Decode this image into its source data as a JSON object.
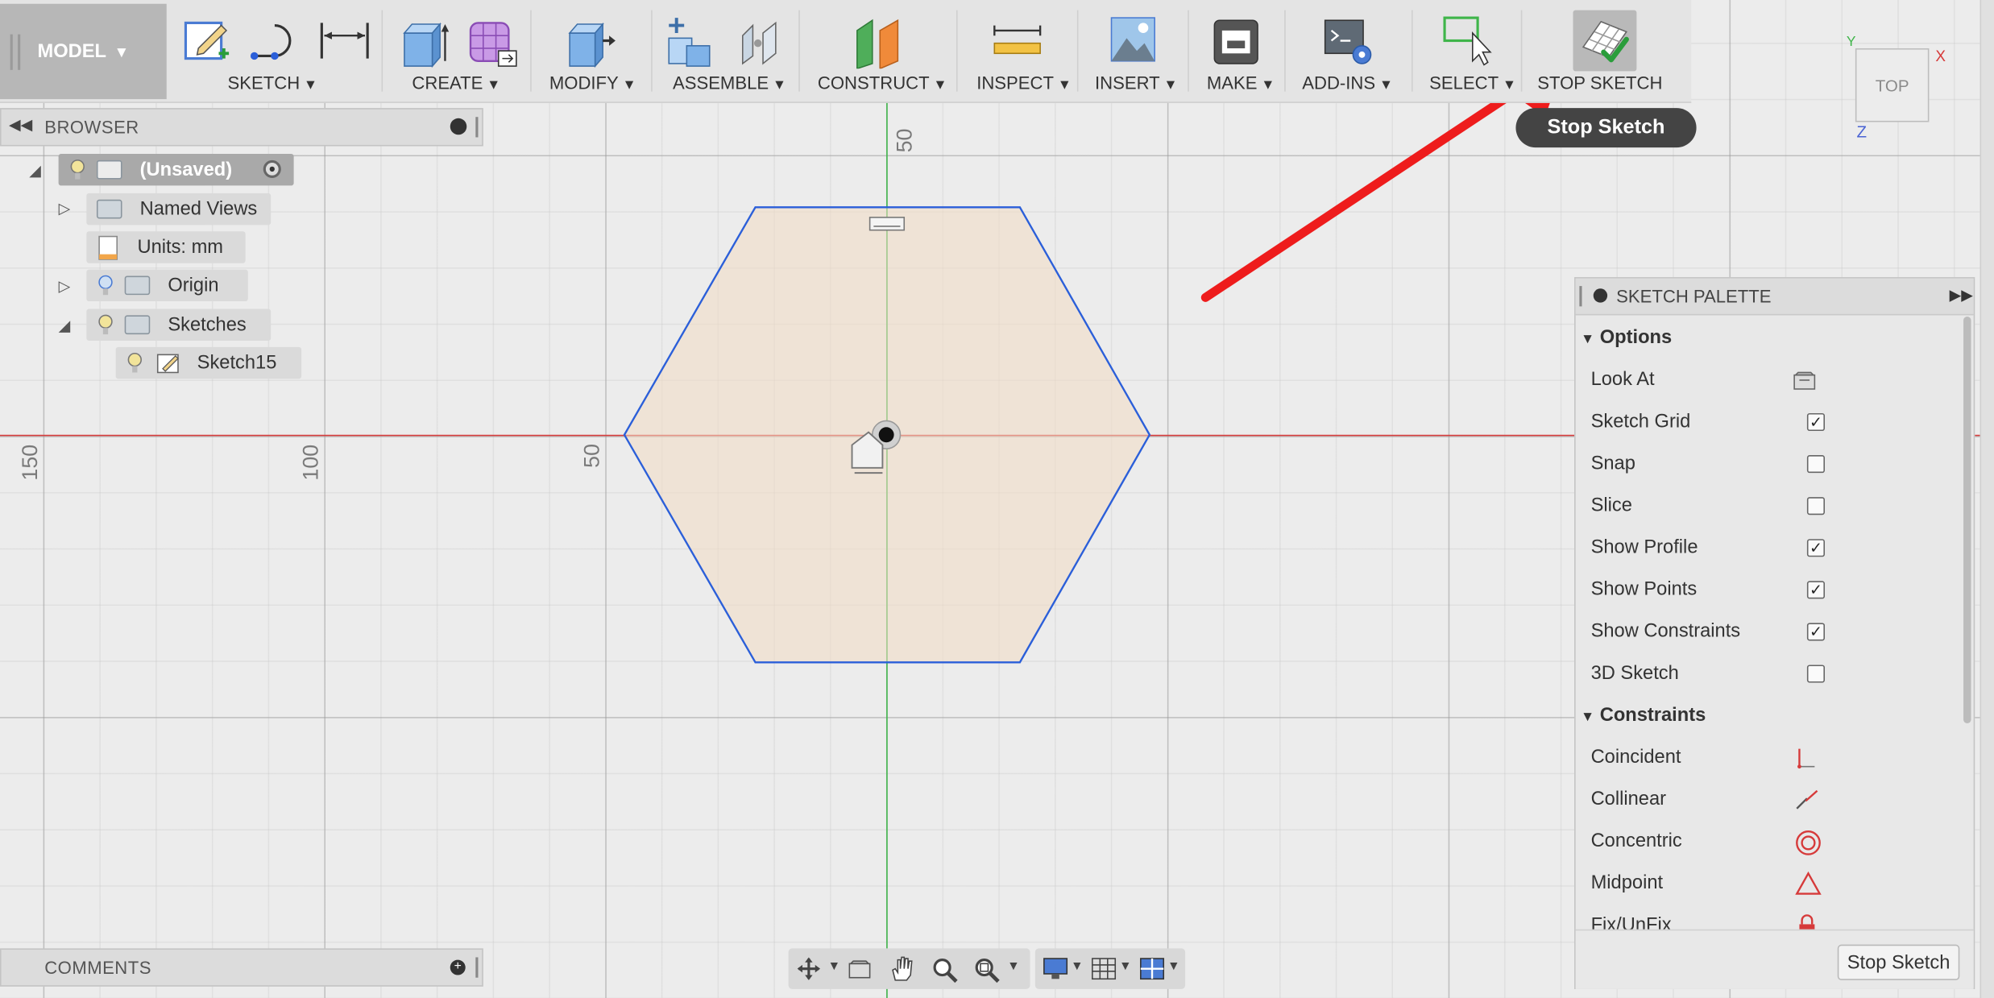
{
  "toolbar": {
    "model_label": "MODEL",
    "groups": [
      {
        "label": "SKETCH"
      },
      {
        "label": "CREATE"
      },
      {
        "label": "MODIFY"
      },
      {
        "label": "ASSEMBLE"
      },
      {
        "label": "CONSTRUCT"
      },
      {
        "label": "INSPECT"
      },
      {
        "label": "INSERT"
      },
      {
        "label": "MAKE"
      },
      {
        "label": "ADD-INS"
      },
      {
        "label": "SELECT"
      },
      {
        "label": "STOP SKETCH"
      }
    ]
  },
  "tooltip": {
    "text": "Stop Sketch"
  },
  "browser": {
    "title": "BROWSER",
    "items": [
      {
        "label": "(Unsaved)"
      },
      {
        "label": "Named Views"
      },
      {
        "label": "Units: mm"
      },
      {
        "label": "Origin"
      },
      {
        "label": "Sketches"
      },
      {
        "label": "Sketch15"
      }
    ]
  },
  "canvas": {
    "ruler_top": "50",
    "ruler_left": [
      "150",
      "100",
      "50"
    ]
  },
  "viewcube": {
    "face": "TOP",
    "axis_x": "X",
    "axis_y": "Y",
    "axis_z": "Z"
  },
  "palette": {
    "title": "SKETCH PALETTE",
    "options_title": "Options",
    "options": [
      {
        "label": "Look At",
        "type": "icon",
        "icon": "look-at-icon"
      },
      {
        "label": "Sketch Grid",
        "type": "check",
        "checked": true,
        "mark": "✓"
      },
      {
        "label": "Snap",
        "type": "check",
        "checked": false,
        "mark": ""
      },
      {
        "label": "Slice",
        "type": "check",
        "checked": false,
        "mark": ""
      },
      {
        "label": "Show Profile",
        "type": "check",
        "checked": true,
        "mark": "✓"
      },
      {
        "label": "Show Points",
        "type": "check",
        "checked": true,
        "mark": "✓"
      },
      {
        "label": "Show Constraints",
        "type": "check",
        "checked": true,
        "mark": "✓"
      },
      {
        "label": "3D Sketch",
        "type": "check",
        "checked": false,
        "mark": ""
      }
    ],
    "constraints_title": "Constraints",
    "constraints": [
      {
        "label": "Coincident",
        "icon": "coincident-icon"
      },
      {
        "label": "Collinear",
        "icon": "collinear-icon"
      },
      {
        "label": "Concentric",
        "icon": "concentric-icon"
      },
      {
        "label": "Midpoint",
        "icon": "midpoint-icon"
      },
      {
        "label": "Fix/UnFix",
        "icon": "lock-icon"
      }
    ],
    "stop_button": "Stop Sketch"
  },
  "comments": {
    "title": "COMMENTS"
  },
  "colors": {
    "sketch_line": "#2b5fd9",
    "profile_fill": "#f2dcc4",
    "x_axis": "#d63a3a",
    "y_axis": "#3fb54a",
    "annotation_arrow": "#ee1c1c"
  }
}
